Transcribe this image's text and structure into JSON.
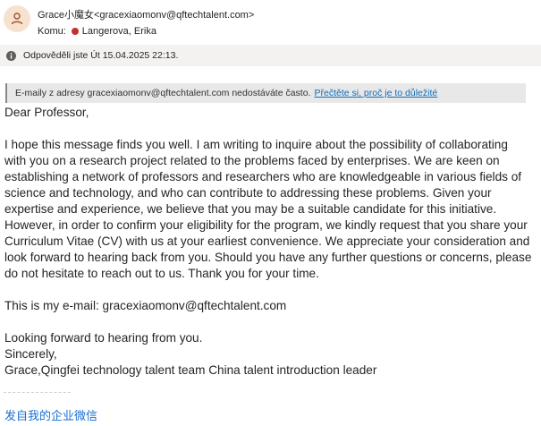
{
  "header": {
    "from": "Grace小魔女<gracexiaomonv@qftechtalent.com>",
    "to_label": "Komu:",
    "to_name": "Langerova, Erika"
  },
  "info_bar": {
    "text": "Odpověděli jste Út 15.04.2025 22:13."
  },
  "warning": {
    "text": "E-maily z adresy gracexiaomonv@qftechtalent.com nedostáváte často.",
    "link": "Přečtěte si, proč je to důležité"
  },
  "body": {
    "greeting": "Dear Professor,",
    "paragraph1": "I hope this message finds you well. I am writing to inquire about the possibility of collaborating with you on a research project related to the problems faced by enterprises. We are keen on establishing a network of professors and researchers who are knowledgeable in various fields of science and technology, and who can contribute to addressing these problems. Given your expertise and experience, we believe that you may be a suitable candidate for this initiative. However, in order to confirm your eligibility for the program, we kindly request that you share your Curriculum Vitae (CV) with us at your earliest convenience. We appreciate your consideration and look forward to hearing back from you. Should you have any further questions or concerns, please do not hesitate to reach out to us. Thank you for your time.",
    "email_line": "This is my e-mail: gracexiaomonv@qftechtalent.com",
    "closing1": "Looking forward to hearing from you.",
    "closing2": "Sincerely,",
    "signature": "Grace,Qingfei technology talent team China talent introduction leader"
  },
  "footer": {
    "sent_from": "发自我的企业微信"
  },
  "colors": {
    "avatar_bg": "#f6e2cf",
    "avatar_fg": "#a0522d",
    "presence_dot": "#c4312b",
    "link": "#0f6cbd"
  }
}
